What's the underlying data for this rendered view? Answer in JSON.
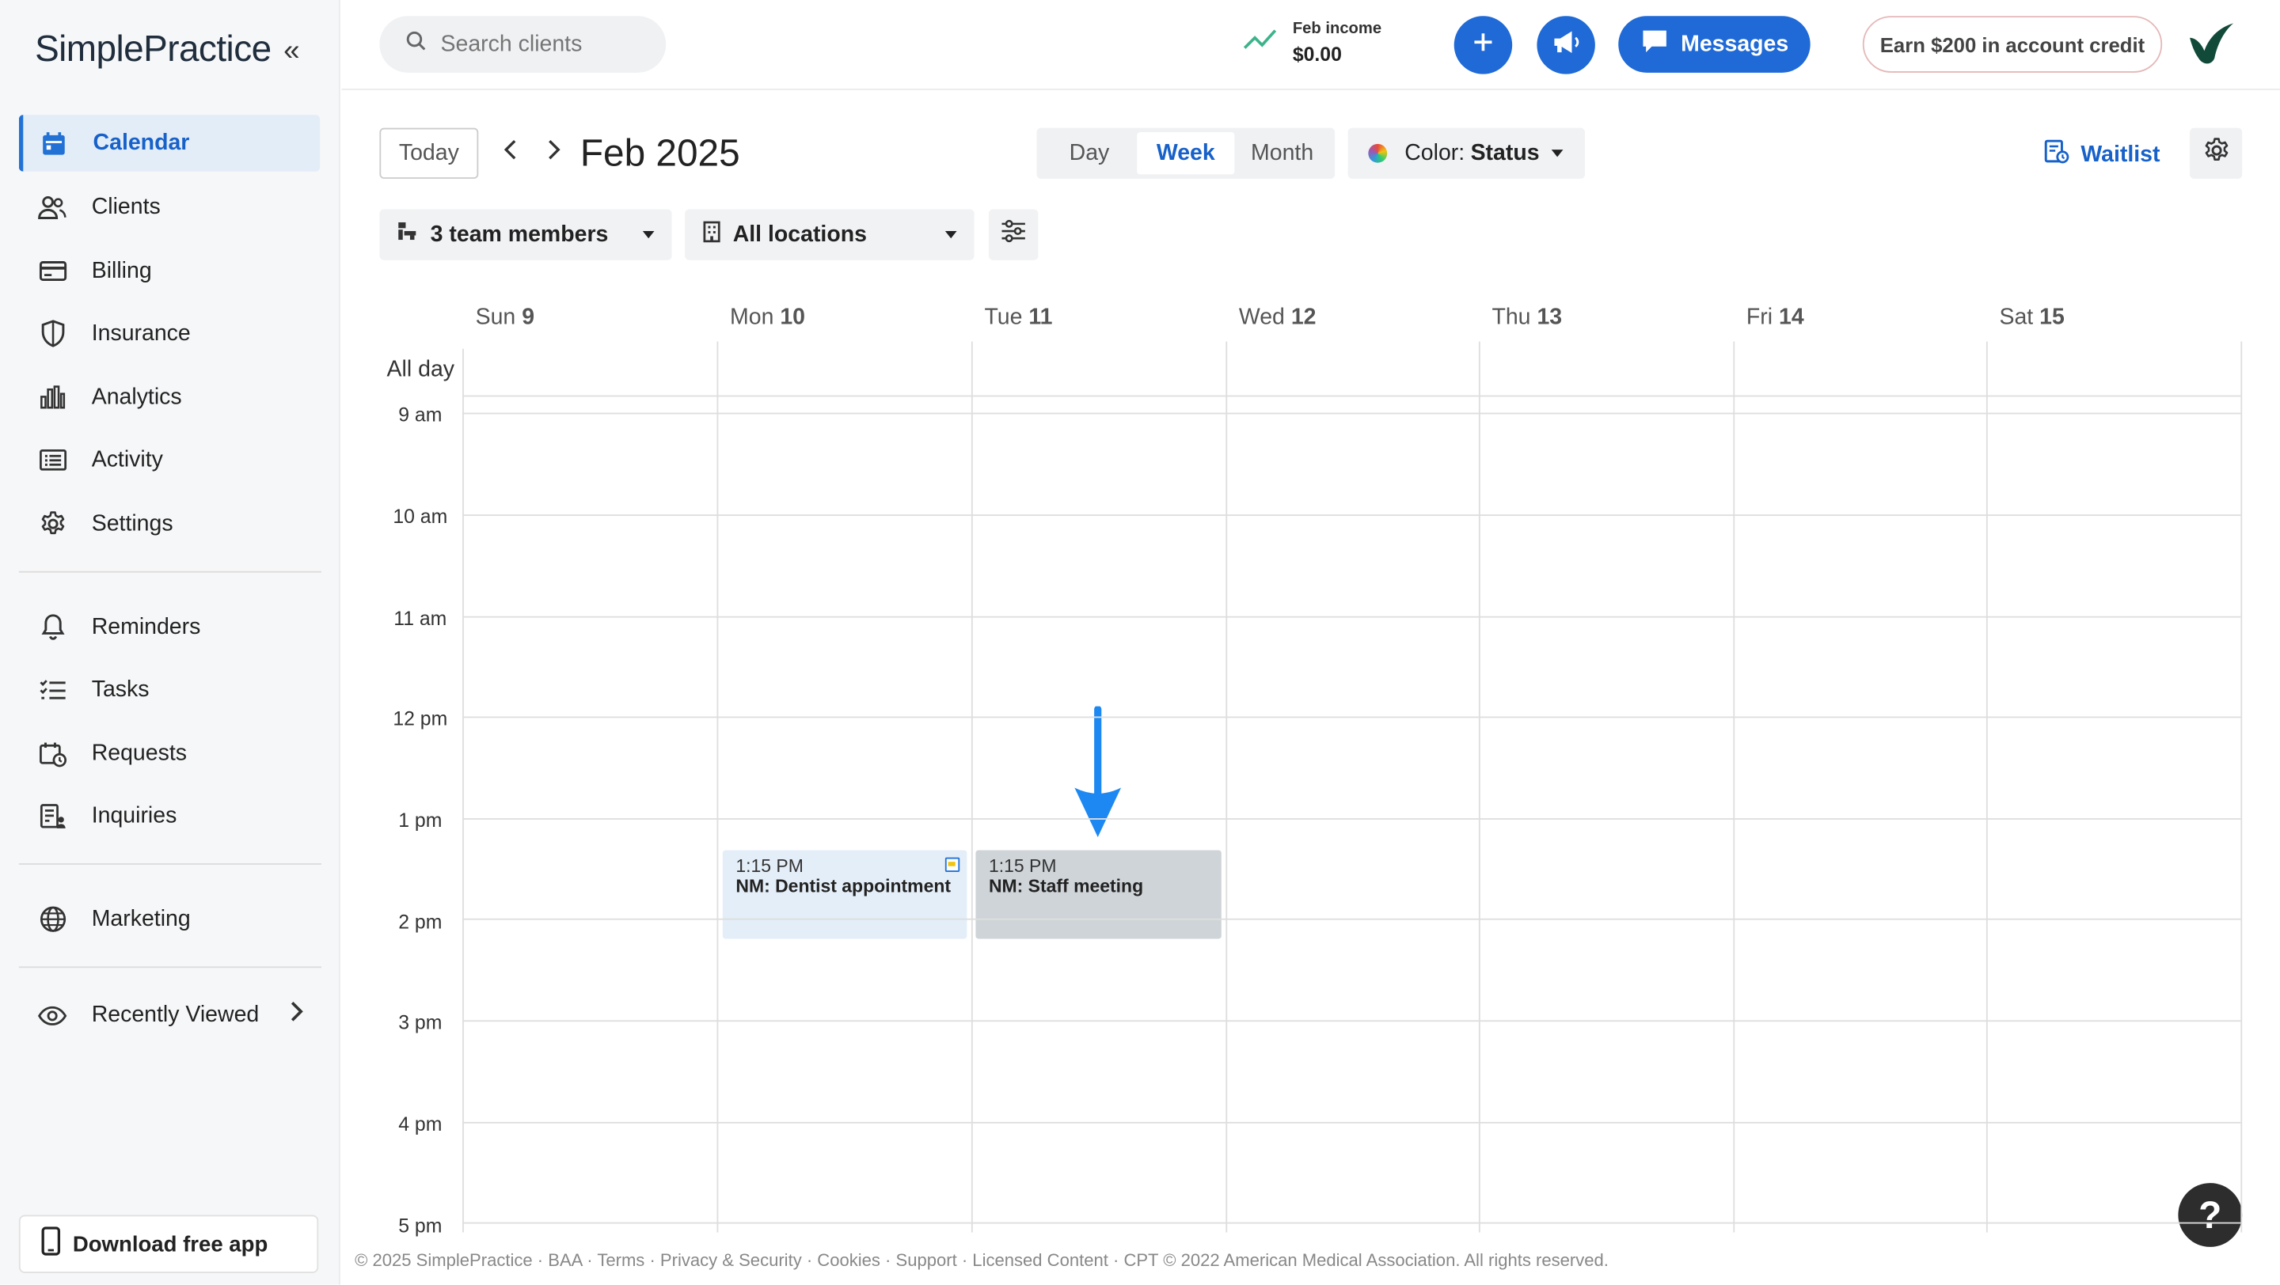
{
  "sidebar": {
    "brand": "SimplePractice",
    "primary": [
      {
        "label": "Calendar",
        "icon": "calendar-icon",
        "active": true
      },
      {
        "label": "Clients",
        "icon": "clients-icon"
      },
      {
        "label": "Billing",
        "icon": "credit-card-icon"
      },
      {
        "label": "Insurance",
        "icon": "shield-icon"
      },
      {
        "label": "Analytics",
        "icon": "bar-chart-icon"
      },
      {
        "label": "Activity",
        "icon": "list-icon"
      },
      {
        "label": "Settings",
        "icon": "gear-icon"
      }
    ],
    "secondary": [
      {
        "label": "Reminders",
        "icon": "bell-icon"
      },
      {
        "label": "Tasks",
        "icon": "checklist-icon"
      },
      {
        "label": "Requests",
        "icon": "calendar-clock-icon"
      },
      {
        "label": "Inquiries",
        "icon": "inquiry-icon"
      }
    ],
    "marketing": {
      "label": "Marketing",
      "icon": "globe-icon"
    },
    "recently_viewed": {
      "label": "Recently Viewed",
      "icon": "eye-icon"
    },
    "download": {
      "label": "Download free app",
      "icon": "phone-icon"
    }
  },
  "header": {
    "search_placeholder": "Search clients",
    "income_label": "Feb income",
    "income_value": "$0.00",
    "messages_label": "Messages",
    "credit_label": "Earn $200 in account credit"
  },
  "toolbar": {
    "today_label": "Today",
    "month_title": "Feb 2025",
    "views": [
      {
        "label": "Day",
        "active": false
      },
      {
        "label": "Week",
        "active": true
      },
      {
        "label": "Month",
        "active": false
      }
    ],
    "color_label": "Color:",
    "color_value": "Status",
    "waitlist_label": "Waitlist",
    "team_filter": "3 team members",
    "location_filter": "All locations"
  },
  "calendar": {
    "all_day_label": "All day",
    "days": [
      {
        "dow": "Sun",
        "num": "9"
      },
      {
        "dow": "Mon",
        "num": "10"
      },
      {
        "dow": "Tue",
        "num": "11"
      },
      {
        "dow": "Wed",
        "num": "12"
      },
      {
        "dow": "Thu",
        "num": "13"
      },
      {
        "dow": "Fri",
        "num": "14"
      },
      {
        "dow": "Sat",
        "num": "15"
      }
    ],
    "times": [
      "9 am",
      "10 am",
      "11 am",
      "12 pm",
      "1 pm",
      "2 pm",
      "3 pm",
      "4 pm",
      "5 pm"
    ],
    "events": [
      {
        "time": "1:15 PM",
        "title": "NM: Dentist appointment"
      },
      {
        "time": "1:15 PM",
        "title": "NM: Staff meeting"
      }
    ]
  },
  "footer": "© 2025 SimplePractice · BAA · Terms · Privacy & Security · Cookies · Support · Licensed Content · CPT © 2022 American Medical Association. All rights reserved.",
  "help_label": "?",
  "colors": {
    "accent": "#1f6ad6",
    "active_bg": "#e3edf8",
    "event_blue": "#e4eef8",
    "event_gray": "#cfd4d8",
    "arrow": "#1e88f2"
  }
}
